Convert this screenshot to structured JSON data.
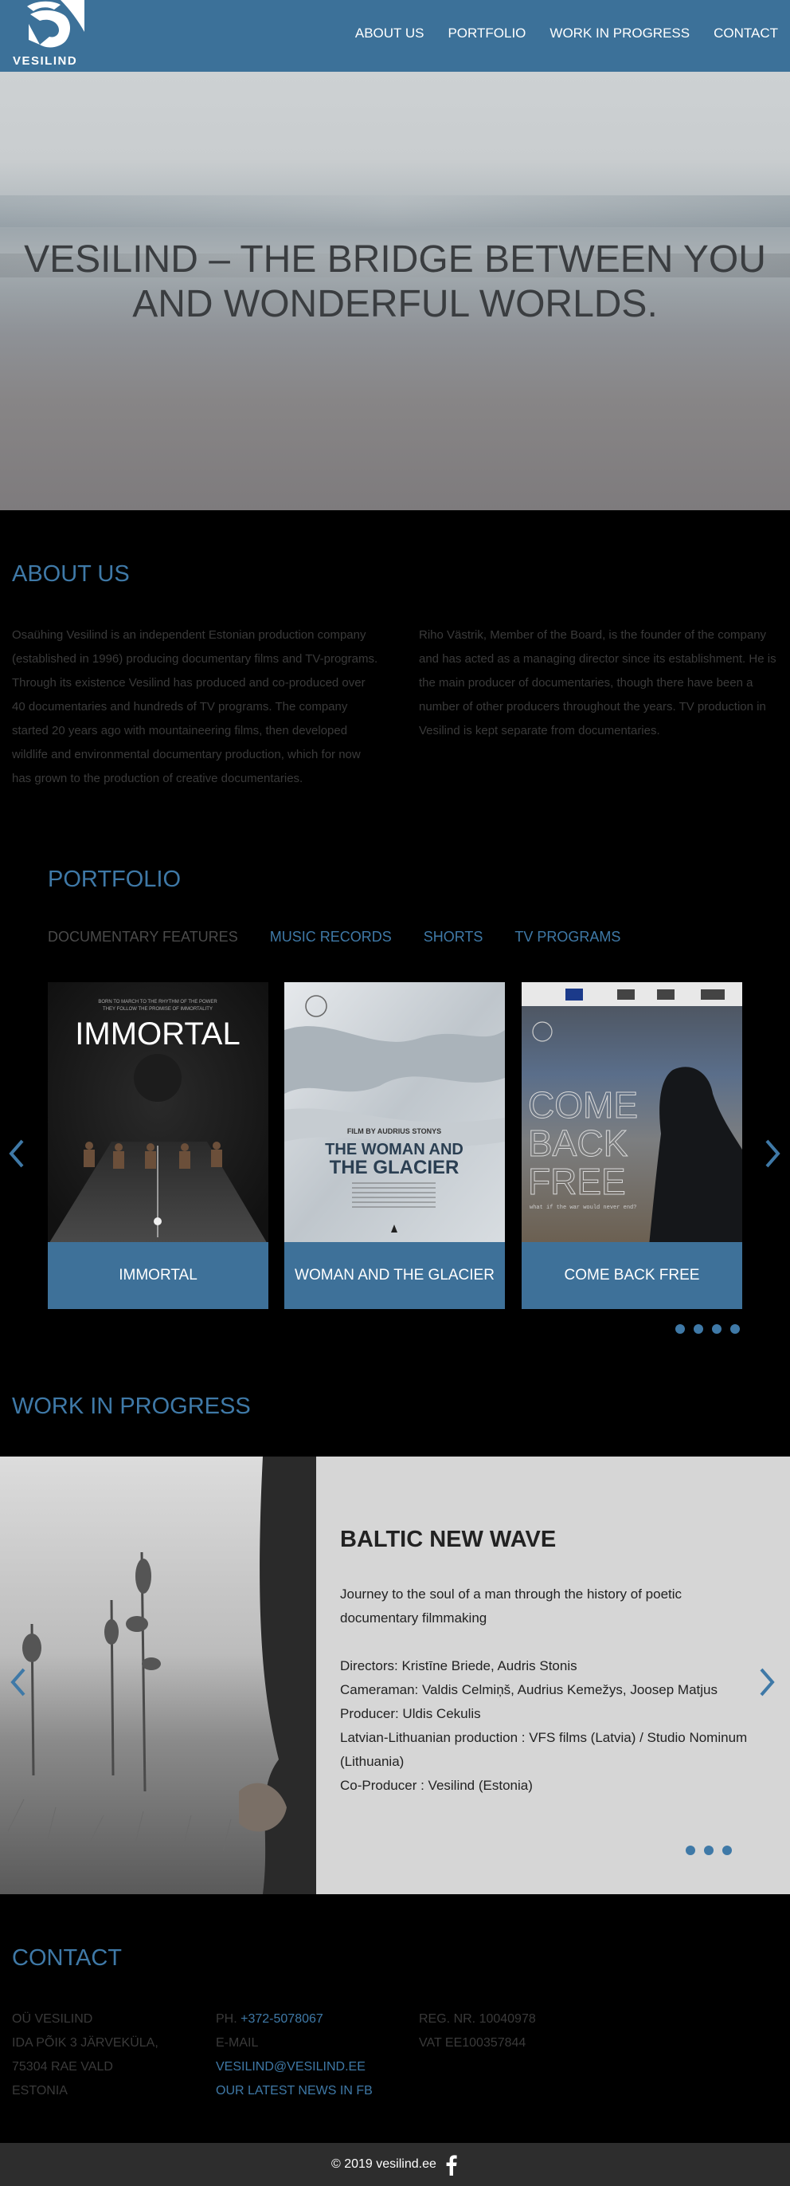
{
  "header": {
    "logo_text": "VESILIND",
    "nav": [
      "ABOUT US",
      "PORTFOLIO",
      "WORK IN PROGRESS",
      "CONTACT"
    ]
  },
  "hero": {
    "title_line1": "VESILIND – THE BRIDGE BETWEEN YOU",
    "title_line2": "AND WONDERFUL WORLDS."
  },
  "about": {
    "title": "ABOUT US",
    "col1": "Osaühing Vesilind is an independent Estonian production company (established in 1996) producing documentary films and TV-programs. Through its existence Vesilind has produced and co-produced over 40 documentaries and hundreds of TV programs. The company started 20 years ago with mountaineering films, then developed wildlife and environmental documentary production, which for now has grown to the production of creative documentaries.",
    "col2": "Riho Västrik, Member of the Board, is the founder of the company and has acted as a managing director since its establishment. He is the main producer of documentaries, though there have been a number of other producers throughout the years. TV production in Vesilind is kept separate from documentaries."
  },
  "portfolio": {
    "title": "PORTFOLIO",
    "tabs": [
      "DOCUMENTARY FEATURES",
      "MUSIC RECORDS",
      "SHORTS",
      "TV PROGRAMS"
    ],
    "cards": [
      {
        "caption": "IMMORTAL",
        "poster_title": "IMMORTAL",
        "poster_tagline_1": "BORN TO MARCH TO THE RHYTHM OF THE POWER",
        "poster_tagline_2": "THEY FOLLOW THE PROMISE OF IMMORTALITY"
      },
      {
        "caption": "WOMAN AND THE GLACIER",
        "poster_credit": "FILM BY AUDRIUS STONYS",
        "poster_title_1": "THE WOMAN AND",
        "poster_title_2": "THE GLACIER"
      },
      {
        "caption": "COME BACK FREE",
        "poster_title_1": "COME",
        "poster_title_2": "BACK",
        "poster_title_3": "FREE",
        "poster_tagline": "what if the war would never end?"
      }
    ]
  },
  "wip": {
    "title": "WORK IN PROGRESS",
    "project_title": "BALTIC NEW WAVE",
    "description": "Journey to the soul of a man through the history of poetic documentary filmmaking",
    "credits": [
      "Directors: Kristīne Briede, Audris Stonis",
      "Cameraman: Valdis Celmiņš, Audrius Kemežys, Joosep Matjus",
      "Producer: Uldis Cekulis",
      "Latvian-Lithuanian production : VFS films (Latvia) / Studio Nominum (Lithuania)",
      "Co-Producer : Vesilind (Estonia)"
    ]
  },
  "contact": {
    "title": "CONTACT",
    "address": [
      "OÜ VESILIND",
      "IDA PÕIK 3 JÄRVEKÜLA,",
      "75304 RAE VALD",
      "ESTONIA"
    ],
    "phone_label": "PH.",
    "phone": "+372-5078067",
    "email_label": "E-MAIL",
    "email": "VESILIND@VESILIND.EE",
    "news_link": "OUR LATEST NEWS IN FB",
    "reg": "REG. NR. 10040978",
    "vat": "VAT EE100357844"
  },
  "footer": {
    "copyright": "© 2019 vesilind.ee"
  },
  "icons": {
    "facebook": "facebook-icon",
    "prev": "chevron-left-icon",
    "next": "chevron-right-icon"
  },
  "colors": {
    "brand": "#3c7199",
    "accent": "#3f79a7",
    "footer": "#2d2d2d"
  }
}
